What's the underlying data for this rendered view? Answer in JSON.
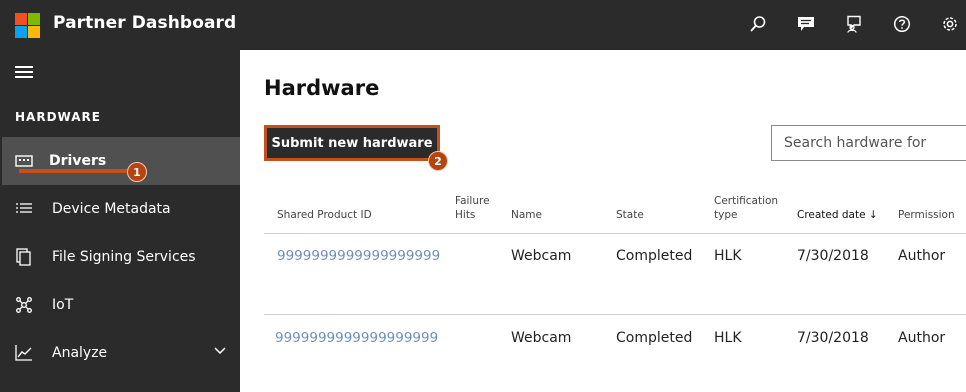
{
  "app": {
    "title": "Partner Dashboard",
    "logo_colors": [
      "#f25022",
      "#7fba00",
      "#00a4ef",
      "#ffb900"
    ]
  },
  "topbar_icons": [
    "search-icon",
    "feedback-icon",
    "people-icon",
    "help-icon",
    "gear-icon"
  ],
  "sidebar": {
    "section": "HARDWARE",
    "items": [
      {
        "label": "Drivers",
        "icon": "driver-icon",
        "active": true
      },
      {
        "label": "Device Metadata",
        "icon": "list-icon",
        "active": false
      },
      {
        "label": "File Signing Services",
        "icon": "file-icon",
        "active": false
      },
      {
        "label": "IoT",
        "icon": "iot-icon",
        "active": false
      },
      {
        "label": "Analyze",
        "icon": "chart-icon",
        "active": false,
        "expandable": true
      }
    ]
  },
  "callouts": {
    "one": "1",
    "two": "2",
    "color": "#b64411"
  },
  "main": {
    "title": "Hardware",
    "submit_label": "Submit new hardware",
    "search_placeholder": "Search hardware for"
  },
  "table": {
    "headers": {
      "shared_product_id": "Shared Product ID",
      "failure_hits_line1": "Failure",
      "failure_hits_line2": "Hits",
      "name": "Name",
      "state": "State",
      "cert_line1": "Certification",
      "cert_line2": "type",
      "created_date": "Created date",
      "permission": "Permission"
    },
    "rows": [
      {
        "id": "9999999999999999999",
        "name": "Webcam",
        "state": "Completed",
        "cert": "HLK",
        "date": "7/30/2018",
        "permission": "Author"
      },
      {
        "id": "9999999999999999999",
        "name": "Webcam",
        "state": "Completed",
        "cert": "HLK",
        "date": "7/30/2018",
        "permission": "Author"
      }
    ]
  }
}
